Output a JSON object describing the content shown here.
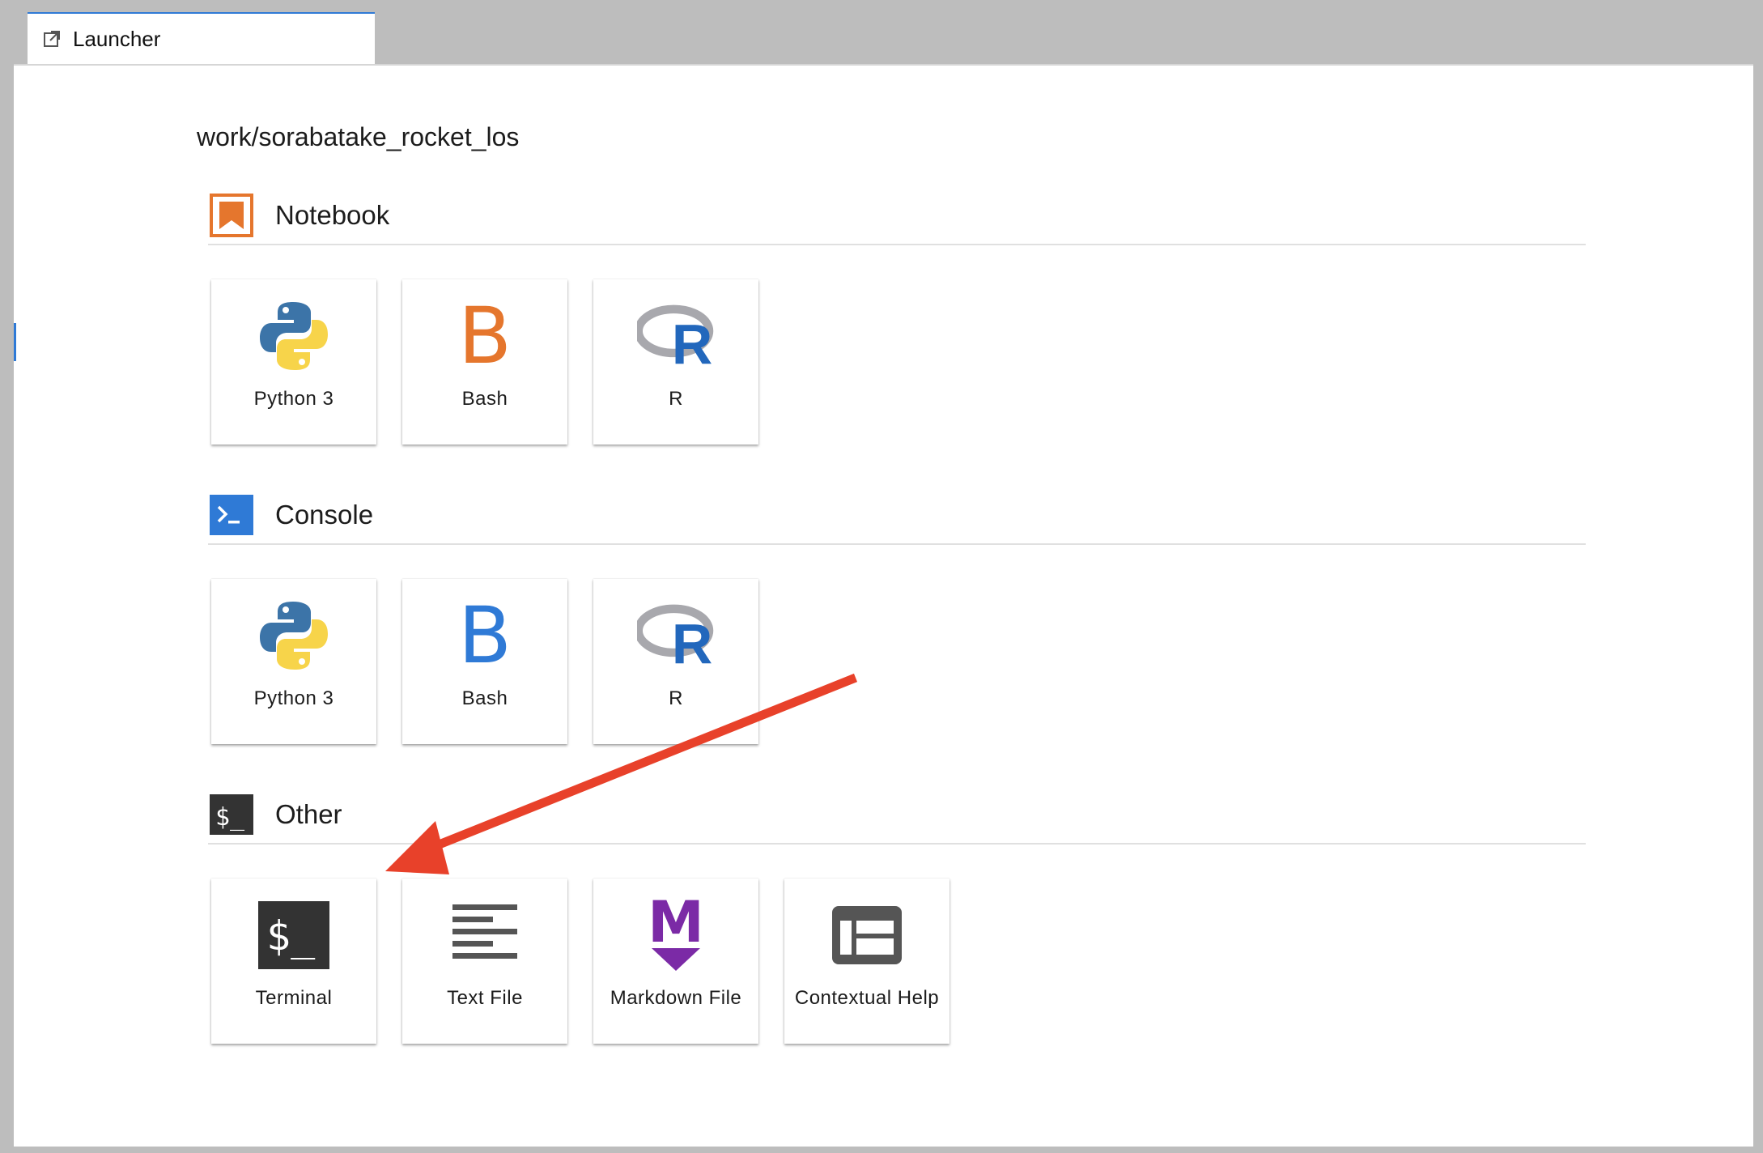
{
  "tab": {
    "label": "Launcher",
    "icon": "launch-icon"
  },
  "path": "work/sorabatake_rocket_los",
  "sections": [
    {
      "title": "Notebook",
      "icon": "notebook-icon",
      "items": [
        {
          "label": "Python 3",
          "icon": "python-icon"
        },
        {
          "label": "Bash",
          "icon": "bash-icon"
        },
        {
          "label": "R",
          "icon": "r-icon"
        }
      ]
    },
    {
      "title": "Console",
      "icon": "console-icon",
      "items": [
        {
          "label": "Python 3",
          "icon": "python-icon"
        },
        {
          "label": "Bash",
          "icon": "bash-icon"
        },
        {
          "label": "R",
          "icon": "r-icon"
        }
      ]
    },
    {
      "title": "Other",
      "icon": "terminal-icon",
      "items": [
        {
          "label": "Terminal",
          "icon": "terminal-icon"
        },
        {
          "label": "Text File",
          "icon": "text-file-icon"
        },
        {
          "label": "Markdown File",
          "icon": "markdown-icon"
        },
        {
          "label": "Contextual Help",
          "icon": "contextual-help-icon"
        }
      ]
    }
  ],
  "icon_text": {
    "bash": "B",
    "r": "R",
    "terminal": "$_",
    "markdown": "M"
  },
  "colors": {
    "notebook_orange": "#e5762d",
    "console_blue": "#2f7ad6",
    "terminal_dark": "#333333",
    "markdown_purple": "#7b2aa6",
    "annotation_arrow": "#e8412a"
  }
}
